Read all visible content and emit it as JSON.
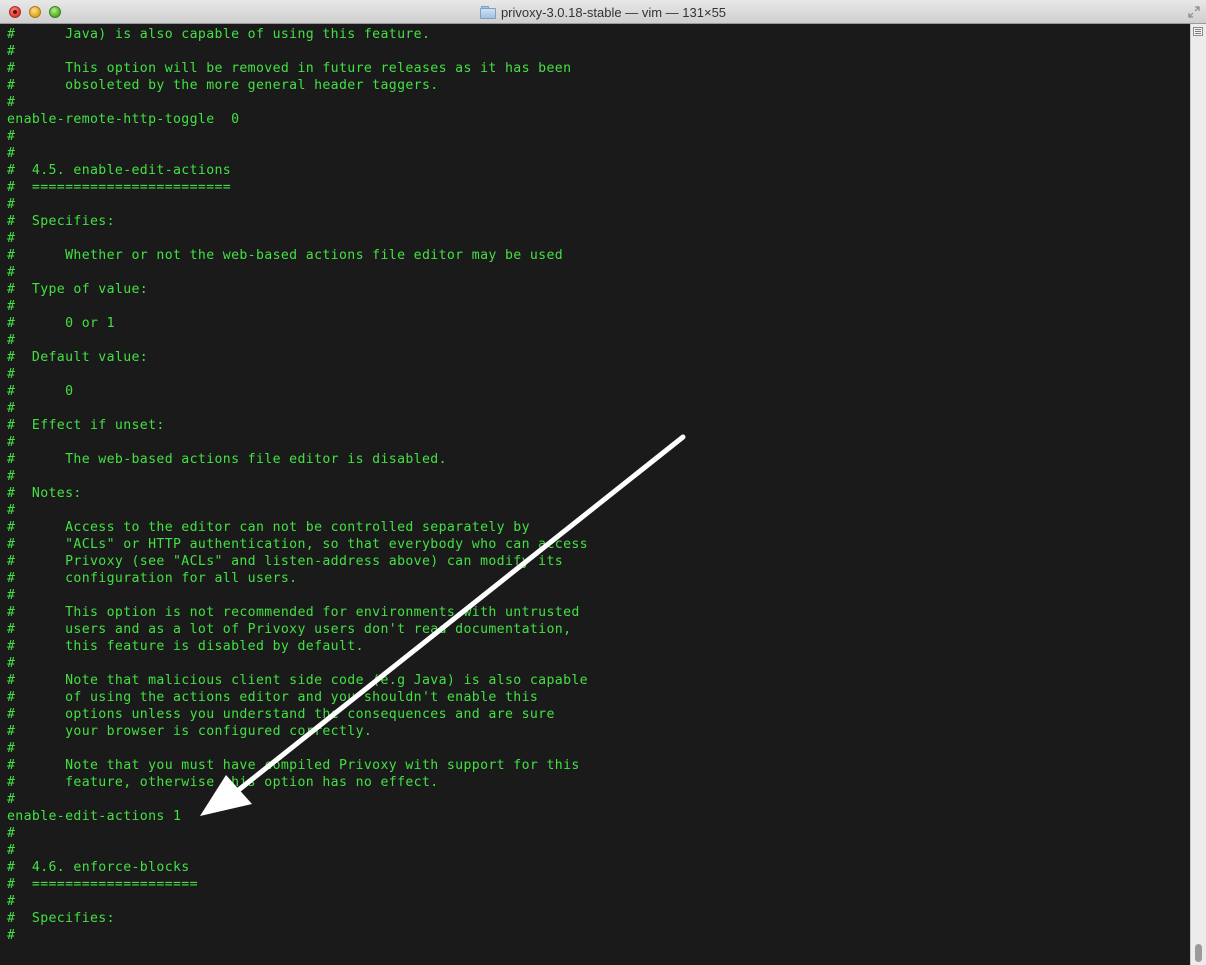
{
  "window": {
    "title": "privoxy-3.0.18-stable — vim — 131×55",
    "text_color": "#43e043",
    "background": "#1a1a1a"
  },
  "editor": {
    "lines": [
      "#      Java) is also capable of using this feature.",
      "#",
      "#      This option will be removed in future releases as it has been",
      "#      obsoleted by the more general header taggers.",
      "#",
      "enable-remote-http-toggle  0",
      "#",
      "#",
      "#  4.5. enable-edit-actions",
      "#  ========================",
      "#",
      "#  Specifies:",
      "#",
      "#      Whether or not the web-based actions file editor may be used",
      "#",
      "#  Type of value:",
      "#",
      "#      0 or 1",
      "#",
      "#  Default value:",
      "#",
      "#      0",
      "#",
      "#  Effect if unset:",
      "#",
      "#      The web-based actions file editor is disabled.",
      "#",
      "#  Notes:",
      "#",
      "#      Access to the editor can not be controlled separately by",
      "#      \"ACLs\" or HTTP authentication, so that everybody who can access",
      "#      Privoxy (see \"ACLs\" and listen-address above) can modify its",
      "#      configuration for all users.",
      "#",
      "#      This option is not recommended for environments with untrusted",
      "#      users and as a lot of Privoxy users don't read documentation,",
      "#      this feature is disabled by default.",
      "#",
      "#      Note that malicious client side code (e.g Java) is also capable",
      "#      of using the actions editor and you shouldn't enable this",
      "#      options unless you understand the consequences and are sure",
      "#      your browser is configured correctly.",
      "#",
      "#      Note that you must have compiled Privoxy with support for this",
      "#      feature, otherwise this option has no effect.",
      "#",
      "enable-edit-actions 1",
      "#",
      "#",
      "#  4.6. enforce-blocks",
      "#  ====================",
      "#",
      "#  Specifies:",
      "#"
    ]
  },
  "annotation": {
    "type": "arrow",
    "color": "#ffffff",
    "target": "enable-edit-actions 1"
  }
}
